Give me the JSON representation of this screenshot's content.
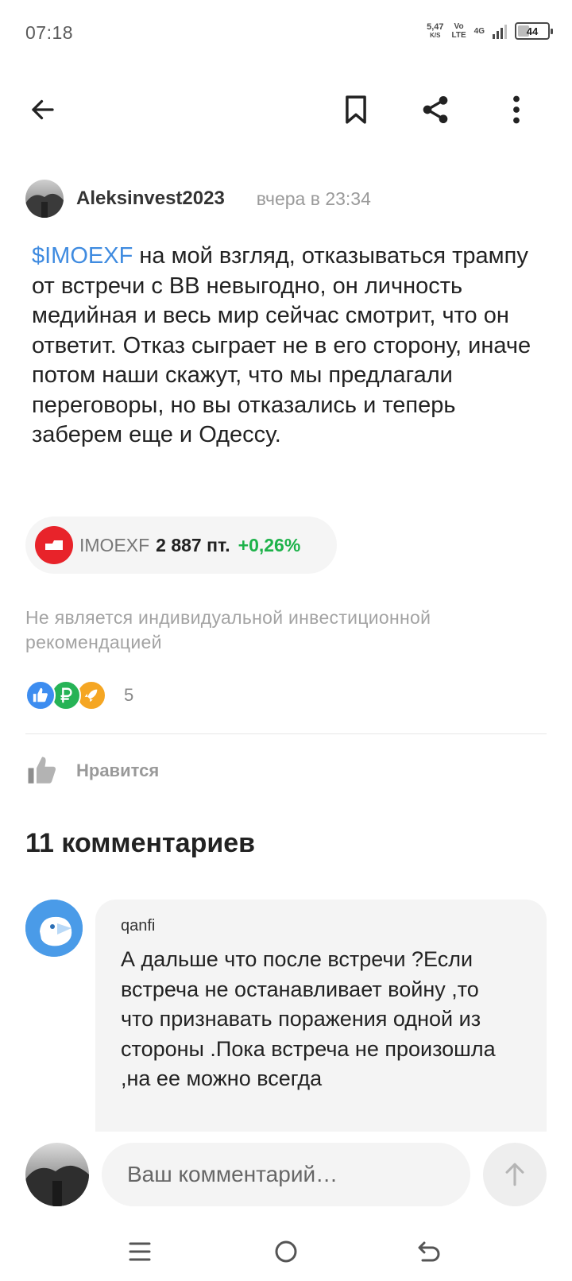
{
  "status_bar": {
    "time": "07:18",
    "net_speed": "5,47",
    "net_speed_unit": "K/S",
    "net_type_top": "Vo",
    "net_type_bottom": "LTE",
    "net_gen": "4G",
    "battery_level": 44,
    "battery_text": "44"
  },
  "toolbar": {
    "back_icon": "arrow-left-icon",
    "bookmark_icon": "bookmark-icon",
    "share_icon": "share-icon",
    "more_icon": "more-vertical-icon"
  },
  "post": {
    "author": "Aleksinvest2023",
    "time": "вчера в 23:34",
    "ticker_link": "$IMOEXF",
    "text": " на мой взгляд, отказываться трампу от встречи с ВВ невыгодно, он личность медийная и весь мир сейчас смотрит, что он ответит. Отказ сыграет не в его сторону, иначе потом наши скажут, что мы предлагали переговоры, но вы отказались и теперь заберем еще и Одессу.",
    "ticker": {
      "name": "IMOEXF",
      "price": "2 887 пт.",
      "change": "+0,26%",
      "change_color": "#1db24a",
      "logo_color": "#e8232a"
    },
    "disclaimer": "Не является индивидуальной инвестиционной рекомендацией",
    "reactions": {
      "icons": [
        "thumbs-up-icon",
        "ruble-icon",
        "rocket-icon"
      ],
      "count": "5"
    },
    "like_label": "Нравится"
  },
  "comments": {
    "title": "11 комментариев",
    "items": [
      {
        "author": "qanfi",
        "text": "А дальше что после встречи ?Если встреча не останавливает войну ,то что признавать поражения одной из стороны .Пока встреча не произошла ,на ее можно всегда"
      }
    ]
  },
  "composer": {
    "placeholder": "Ваш комментарий…",
    "send_icon": "arrow-up-icon"
  },
  "nav": {
    "menu_icon": "menu-icon",
    "home_icon": "home-circle-icon",
    "back_icon": "back-icon"
  },
  "colors": {
    "accent": "#3f8be0",
    "positive": "#1db24a"
  }
}
